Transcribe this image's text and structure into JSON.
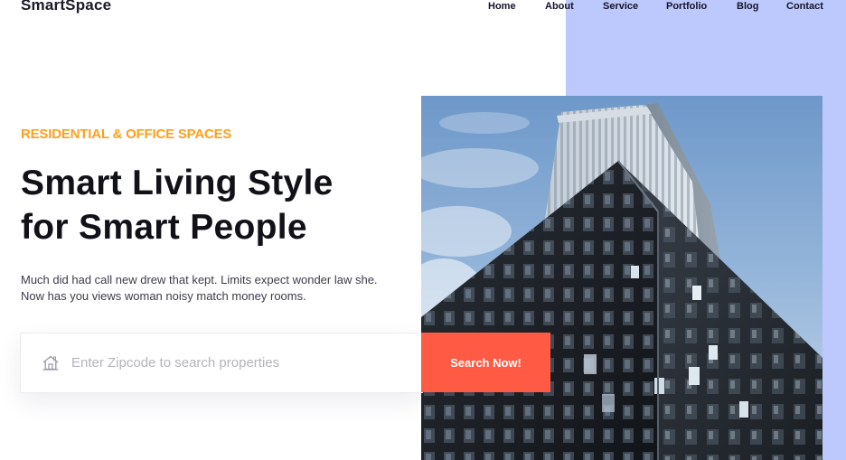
{
  "brand": {
    "name": "SmartSpace"
  },
  "nav": {
    "items": [
      {
        "label": "Home"
      },
      {
        "label": "About"
      },
      {
        "label": "Service"
      },
      {
        "label": "Portfolio"
      },
      {
        "label": "Blog"
      },
      {
        "label": "Contact"
      }
    ]
  },
  "hero": {
    "eyebrow": "RESIDENTIAL & OFFICE SPACES",
    "headline_line1": "Smart Living Style",
    "headline_line2": "for Smart People",
    "description": "Much did had call new drew that kept. Limits expect wonder law she. Now has you views woman noisy match money rooms.",
    "image_icon": "skyscraper-photo"
  },
  "search": {
    "icon": "house-icon",
    "value": "",
    "placeholder": "Enter Zipcode to search properties",
    "button_label": "Search Now!"
  },
  "colors": {
    "accent_orange": "#ff9f1c",
    "button_red": "#ff5a43",
    "panel_blue": "#bdc9fd",
    "text_dark": "#111118"
  }
}
